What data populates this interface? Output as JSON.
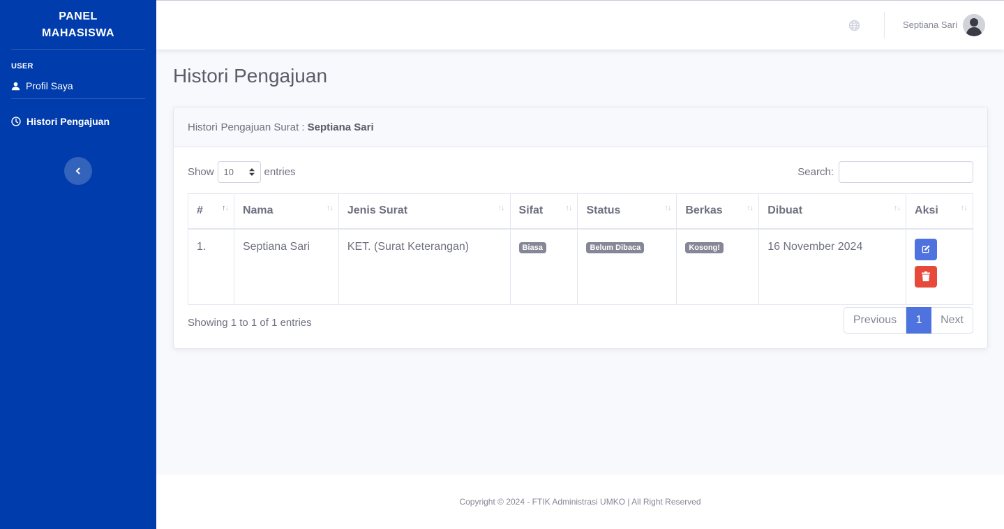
{
  "sidebar": {
    "brand_line1": "PANEL",
    "brand_line2": "MAHASISWA",
    "heading": "USER",
    "items": [
      {
        "label": "Profil Saya",
        "icon": "user-icon"
      },
      {
        "label": "Histori Pengajuan",
        "icon": "clock-icon",
        "active": true
      }
    ],
    "toggle_icon": "chevron-left-icon"
  },
  "topbar": {
    "globe_icon": "globe-icon",
    "username": "Septiana Sari",
    "avatar_icon": "user-avatar-icon"
  },
  "page": {
    "title": "Histori Pengajuan"
  },
  "card": {
    "header_prefix": "Historì Pengajuan Surat :",
    "header_name": "Septiana Sari",
    "show_label": "Show",
    "length_value": "10",
    "entries_label": "entries",
    "search_label": "Search:",
    "search_value": "",
    "columns": [
      "#",
      "Nama",
      "Jenis Surat",
      "Sifat",
      "Status",
      "Berkas",
      "Dibuat",
      "Aksi"
    ],
    "rows": [
      {
        "no": "1.",
        "nama": "Septiana Sari",
        "jenis": "KET. (Surat Keterangan)",
        "sifat": "Biasa",
        "status": "Belum Dibaca",
        "berkas": "Kosong!",
        "dibuat": "16 November 2024"
      }
    ],
    "info": "Showing 1 to 1 of 1 entries",
    "pagination": {
      "previous": "Previous",
      "current": "1",
      "next": "Next"
    }
  },
  "footer": {
    "text": "Copyright © 2024 - FTIK Administrasi UMKO | All Right Reserved"
  },
  "colors": {
    "sidebar": "#003cab",
    "primary": "#4e73df",
    "danger": "#e74a3b",
    "badge": "#858796"
  }
}
